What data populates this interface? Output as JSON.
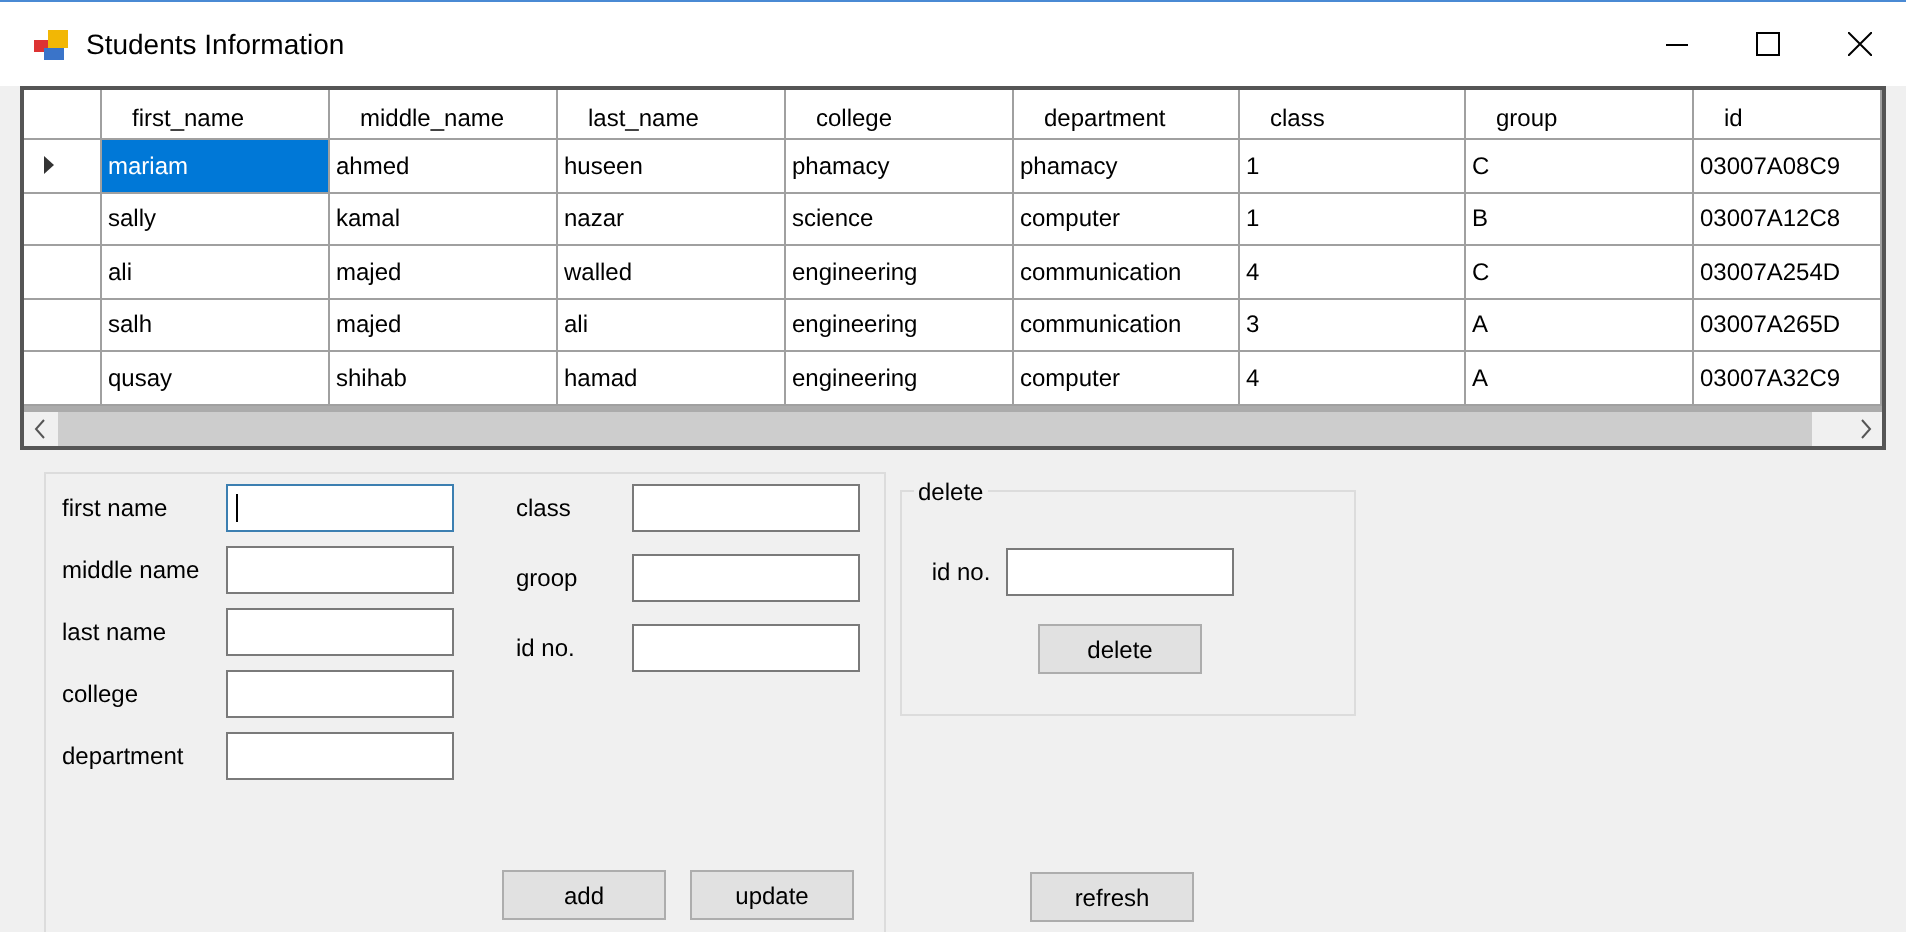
{
  "window": {
    "title": "Students Information"
  },
  "table": {
    "columns": [
      "first_name",
      "middle_name",
      "last_name",
      "college",
      "department",
      "class",
      "group",
      "id"
    ],
    "rows": [
      {
        "selected": true,
        "cells": [
          "mariam",
          "ahmed",
          "huseen",
          "phamacy",
          "phamacy",
          "1",
          "C",
          "03007A08C9"
        ]
      },
      {
        "selected": false,
        "cells": [
          "sally",
          "kamal",
          "nazar",
          "science",
          "computer",
          "1",
          "B",
          "03007A12C8"
        ]
      },
      {
        "selected": false,
        "cells": [
          "ali",
          "majed",
          "walled",
          "engineering",
          "communication",
          "4",
          "C",
          "03007A254D"
        ]
      },
      {
        "selected": false,
        "cells": [
          "salh",
          "majed",
          "ali",
          "engineering",
          "communication",
          "3",
          "A",
          "03007A265D"
        ]
      },
      {
        "selected": false,
        "cells": [
          "qusay",
          "shihab",
          "hamad",
          "engineering",
          "computer",
          "4",
          "A",
          "03007A32C9"
        ]
      }
    ]
  },
  "form": {
    "left_fields": [
      {
        "label": "first name",
        "focused": true
      },
      {
        "label": "middle name",
        "focused": false
      },
      {
        "label": "last name",
        "focused": false
      },
      {
        "label": "college",
        "focused": false
      },
      {
        "label": "department",
        "focused": false
      }
    ],
    "right_fields": [
      {
        "label": "class",
        "focused": false
      },
      {
        "label": "groop",
        "focused": false
      },
      {
        "label": "id no.",
        "focused": false
      }
    ],
    "buttons": [
      "add",
      "update"
    ]
  },
  "delete_group": {
    "title": "delete",
    "field_label": "id no.",
    "button": "delete"
  },
  "refresh_button": "refresh"
}
